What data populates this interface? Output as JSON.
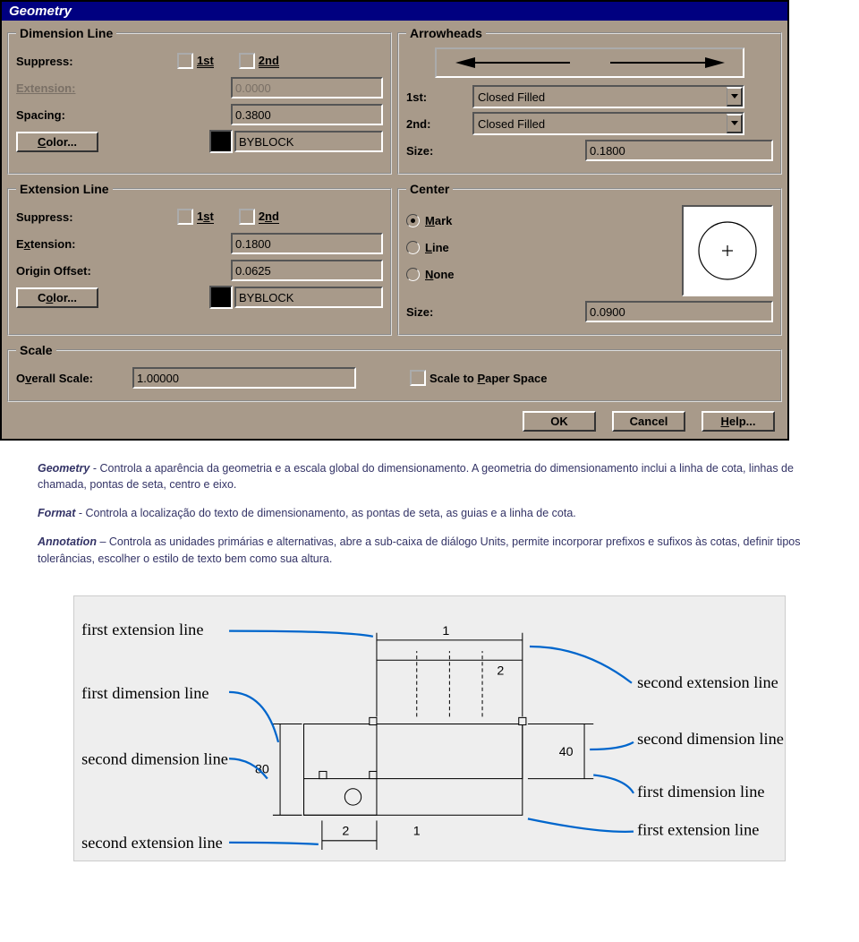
{
  "dialog": {
    "title": "Geometry",
    "dimension_line": {
      "legend": "Dimension Line",
      "suppress_label": "Suppress:",
      "suppress_1st": "1st",
      "suppress_2nd": "2nd",
      "extension_label": "Extension:",
      "extension_value": "0.0000",
      "spacing_label": "Spacing:",
      "spacing_value": "0.3800",
      "color_btn": "Color...",
      "color_value": "BYBLOCK"
    },
    "arrowheads": {
      "legend": "Arrowheads",
      "first_label": "1st:",
      "first_value": "Closed Filled",
      "second_label": "2nd:",
      "second_value": "Closed Filled",
      "size_label": "Size:",
      "size_value": "0.1800"
    },
    "extension_line2": {
      "legend": "Extension Line",
      "suppress_label": "Suppress:",
      "suppress_1st": "1st",
      "suppress_2nd": "2nd",
      "extension_label": "Extension:",
      "extension_value": "0.1800",
      "origin_offset_label": "Origin Offset:",
      "origin_offset_value": "0.0625",
      "color_btn": "Color...",
      "color_value": "BYBLOCK"
    },
    "center": {
      "legend": "Center",
      "mark_label": "Mark",
      "line_label": "Line",
      "none_label": "None",
      "size_label": "Size:",
      "size_value": "0.0900"
    },
    "scale": {
      "legend": "Scale",
      "overall_label": "Overall Scale:",
      "overall_value": "1.00000",
      "paper_label": "Scale to Paper Space"
    },
    "buttons": {
      "ok": "OK",
      "cancel": "Cancel",
      "help": "Help..."
    }
  },
  "doc": {
    "p1a": "Geometry",
    "p1b": " - Controla a aparência da geometria e a escala global do dimensionamento. A geometria do dimensionamento inclui a linha de cota, linhas de chamada, pontas de seta, centro e eixo.",
    "p2a": "Format",
    "p2b": " - Controla a localização do texto de dimensionamento, as pontas de seta, as guias e a linha de cota.",
    "p3a": "Annotation",
    "p3b": " – Controla as unidades primárias e alternativas, abre a sub-caixa de diálogo Units, permite incorporar prefixos e sufixos às cotas, definir tipos tolerâncias, escolher o estilo de texto bem como sua altura."
  },
  "diagram": {
    "first_extension_line": "first extension line",
    "first_dimension_line": "first dimension line",
    "second_dimension_line": "second dimension line",
    "second_extension_line": "second extension line",
    "dim80": "80",
    "dim40": "40",
    "n1": "1",
    "n2": "2"
  }
}
